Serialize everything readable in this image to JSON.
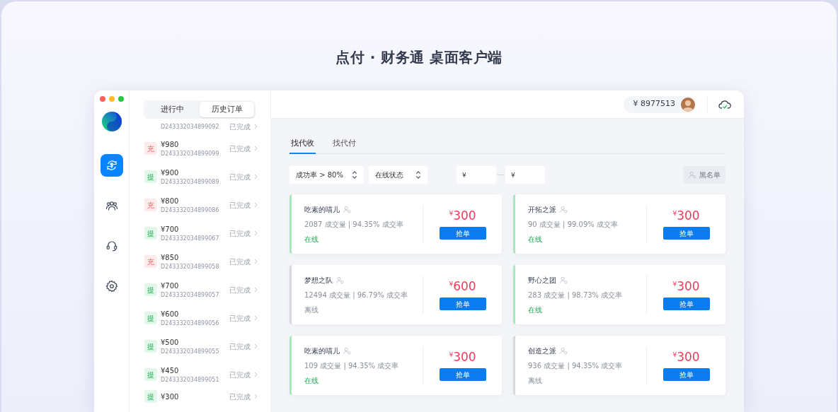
{
  "headline": "点付 · 财务通 桌面客户端",
  "nav": [
    {
      "kind": "exchange",
      "selected": true
    },
    {
      "kind": "users",
      "selected": false
    },
    {
      "kind": "headset",
      "selected": false
    },
    {
      "kind": "settings",
      "selected": false
    }
  ],
  "order_tabs": [
    {
      "label": "进行中",
      "selected": false
    },
    {
      "label": "历史订单",
      "selected": true
    }
  ],
  "orders": [
    {
      "id": "D243332034899092",
      "status": "已完成"
    },
    {
      "type": "充",
      "kind": "deposit",
      "amount": "¥980",
      "id": "D243332034899099",
      "status": "已完成"
    },
    {
      "type": "提",
      "kind": "withdraw",
      "amount": "¥900",
      "id": "D243332034899089",
      "status": "已完成"
    },
    {
      "type": "充",
      "kind": "deposit",
      "amount": "¥800",
      "id": "D243332034899086",
      "status": "已完成"
    },
    {
      "type": "提",
      "kind": "withdraw",
      "amount": "¥700",
      "id": "D243332034899067",
      "status": "已完成"
    },
    {
      "type": "充",
      "kind": "deposit",
      "amount": "¥850",
      "id": "D243332034899058",
      "status": "已完成"
    },
    {
      "type": "提",
      "kind": "withdraw",
      "amount": "¥700",
      "id": "D243332034899057",
      "status": "已完成"
    },
    {
      "type": "提",
      "kind": "withdraw",
      "amount": "¥600",
      "id": "D243332034899056",
      "status": "已完成"
    },
    {
      "type": "提",
      "kind": "withdraw",
      "amount": "¥500",
      "id": "D243332034899055",
      "status": "已完成"
    },
    {
      "type": "提",
      "kind": "withdraw",
      "amount": "¥450",
      "id": "D243332034899051",
      "status": "已完成"
    },
    {
      "type": "提",
      "kind": "withdraw",
      "amount": "¥300",
      "status": "已完成"
    }
  ],
  "balance": "¥ 8977513",
  "main_tabs": [
    {
      "label": "找代收",
      "selected": true
    },
    {
      "label": "找代付",
      "selected": false
    }
  ],
  "filters": {
    "rate": "成功率 > 80%",
    "status": "在线状态",
    "min_placeholder": "¥",
    "max_placeholder": "¥",
    "blacklist": "黑名单"
  },
  "sellers": [
    {
      "name": "吃素的喵儿",
      "stats": "2087 成交量 | 94.35% 成交率",
      "status": "在线",
      "online": true,
      "currency": "¥",
      "price": "300",
      "action": "抢单"
    },
    {
      "name": "开拓之派",
      "stats": "90 成交量 | 99.09% 成交率",
      "status": "在线",
      "online": true,
      "currency": "¥",
      "price": "300",
      "action": "抢单"
    },
    {
      "name": "梦想之队",
      "stats": "12494 成交量 | 96.79% 成交率",
      "status": "离线",
      "online": false,
      "currency": "¥",
      "price": "600",
      "action": "抢单"
    },
    {
      "name": "野心之团",
      "stats": "283 成交量 | 98.73% 成交率",
      "status": "在线",
      "online": true,
      "currency": "¥",
      "price": "300",
      "action": "抢单"
    },
    {
      "name": "吃素的喵儿",
      "stats": "109 成交量 | 94.35% 成交率",
      "status": "在线",
      "online": true,
      "currency": "¥",
      "price": "300",
      "action": "抢单"
    },
    {
      "name": "创造之派",
      "stats": "936 成交量 | 94.35% 成交率",
      "status": "离线",
      "online": false,
      "currency": "¥",
      "price": "300",
      "action": "抢单"
    }
  ]
}
